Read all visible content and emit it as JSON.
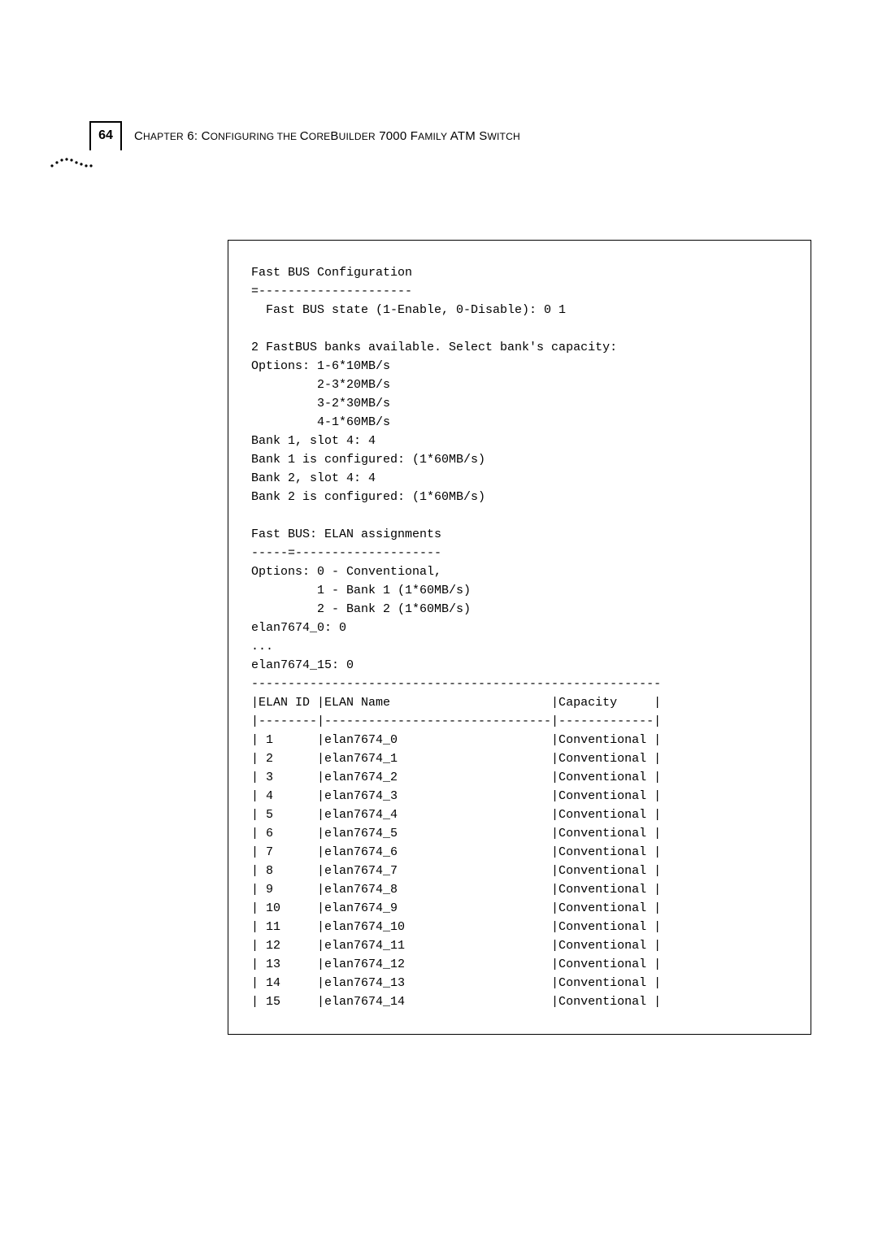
{
  "page_number": "64",
  "chapter_line_prefix": "C",
  "chapter_line_rest1": "HAPTER",
  "chapter_line_num": " 6: C",
  "chapter_line_rest2": "ONFIGURING THE ",
  "chapter_line_cb": "C",
  "chapter_line_rest3": "ORE",
  "chapter_line_b": "B",
  "chapter_line_rest4": "UILDER",
  "chapter_line_model": " 7000 F",
  "chapter_line_rest5": "AMILY",
  "chapter_line_atm": " ATM S",
  "chapter_line_rest6": "WITCH",
  "term": {
    "l01": "Fast BUS Configuration",
    "l02": "=---------------------",
    "l03": "  Fast BUS state (1-Enable, 0-Disable): 0 1",
    "l04": "",
    "l05": "2 FastBUS banks available. Select bank's capacity:",
    "l06": "Options: 1-6*10MB/s",
    "l07": "         2-3*20MB/s",
    "l08": "         3-2*30MB/s",
    "l09": "         4-1*60MB/s",
    "l10": "Bank 1, slot 4: 4",
    "l11": "Bank 1 is configured: (1*60MB/s)",
    "l12": "Bank 2, slot 4: 4",
    "l13": "Bank 2 is configured: (1*60MB/s)",
    "l14": "",
    "l15": "Fast BUS: ELAN assignments",
    "l16": "-----=--------------------",
    "l17": "Options: 0 - Conventional,",
    "l18": "         1 - Bank 1 (1*60MB/s)",
    "l19": "         2 - Bank 2 (1*60MB/s)",
    "l20": "elan7674_0: 0",
    "l21": "...",
    "l22": "elan7674_15: 0",
    "l23": "--------------------------------------------------------",
    "l24": "|ELAN ID |ELAN Name                      |Capacity     |",
    "l25": "|--------|-------------------------------|-------------|",
    "l26": "| 1      |elan7674_0                     |Conventional |",
    "l27": "| 2      |elan7674_1                     |Conventional |",
    "l28": "| 3      |elan7674_2                     |Conventional |",
    "l29": "| 4      |elan7674_3                     |Conventional |",
    "l30": "| 5      |elan7674_4                     |Conventional |",
    "l31": "| 6      |elan7674_5                     |Conventional |",
    "l32": "| 7      |elan7674_6                     |Conventional |",
    "l33": "| 8      |elan7674_7                     |Conventional |",
    "l34": "| 9      |elan7674_8                     |Conventional |",
    "l35": "| 10     |elan7674_9                     |Conventional |",
    "l36": "| 11     |elan7674_10                    |Conventional |",
    "l37": "| 12     |elan7674_11                    |Conventional |",
    "l38": "| 13     |elan7674_12                    |Conventional |",
    "l39": "| 14     |elan7674_13                    |Conventional |",
    "l40": "| 15     |elan7674_14                    |Conventional |"
  },
  "elan_table": {
    "columns": [
      "ELAN ID",
      "ELAN Name",
      "Capacity"
    ],
    "rows": [
      {
        "id": 1,
        "name": "elan7674_0",
        "capacity": "Conventional"
      },
      {
        "id": 2,
        "name": "elan7674_1",
        "capacity": "Conventional"
      },
      {
        "id": 3,
        "name": "elan7674_2",
        "capacity": "Conventional"
      },
      {
        "id": 4,
        "name": "elan7674_3",
        "capacity": "Conventional"
      },
      {
        "id": 5,
        "name": "elan7674_4",
        "capacity": "Conventional"
      },
      {
        "id": 6,
        "name": "elan7674_5",
        "capacity": "Conventional"
      },
      {
        "id": 7,
        "name": "elan7674_6",
        "capacity": "Conventional"
      },
      {
        "id": 8,
        "name": "elan7674_7",
        "capacity": "Conventional"
      },
      {
        "id": 9,
        "name": "elan7674_8",
        "capacity": "Conventional"
      },
      {
        "id": 10,
        "name": "elan7674_9",
        "capacity": "Conventional"
      },
      {
        "id": 11,
        "name": "elan7674_10",
        "capacity": "Conventional"
      },
      {
        "id": 12,
        "name": "elan7674_11",
        "capacity": "Conventional"
      },
      {
        "id": 13,
        "name": "elan7674_12",
        "capacity": "Conventional"
      },
      {
        "id": 14,
        "name": "elan7674_13",
        "capacity": "Conventional"
      },
      {
        "id": 15,
        "name": "elan7674_14",
        "capacity": "Conventional"
      }
    ]
  }
}
